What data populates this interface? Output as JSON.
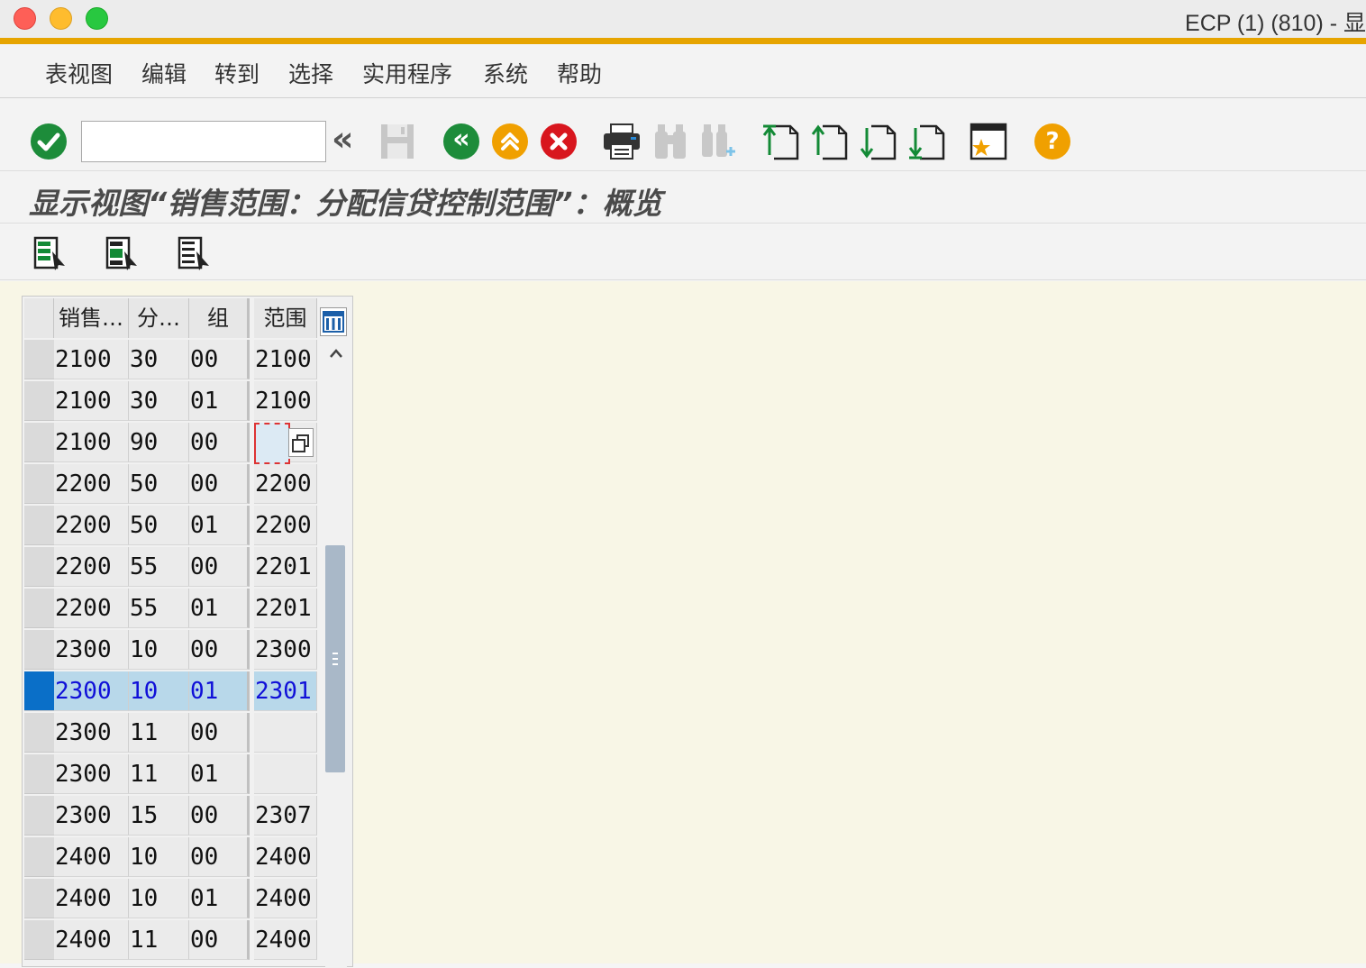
{
  "window": {
    "title": "ECP (1) (810) - 显"
  },
  "menu": [
    "表视图",
    "编辑",
    "转到",
    "选择",
    "实用程序",
    "系统",
    "帮助"
  ],
  "toolbar": {
    "command_value": "",
    "collapse_label": "«",
    "help_label": "?"
  },
  "screen_title": "显示视图“销售范围：分配信贷控制范围”：概览",
  "table": {
    "headers": [
      "销售…",
      "分…",
      "组",
      "范围"
    ],
    "selected_row_index": 8,
    "rows": [
      [
        "2100",
        "30",
        "00",
        "2100"
      ],
      [
        "2100",
        "30",
        "01",
        "2100"
      ],
      [
        "2100",
        "90",
        "00",
        ""
      ],
      [
        "2200",
        "50",
        "00",
        "2200"
      ],
      [
        "2200",
        "50",
        "01",
        "2200"
      ],
      [
        "2200",
        "55",
        "00",
        "2201"
      ],
      [
        "2200",
        "55",
        "01",
        "2201"
      ],
      [
        "2300",
        "10",
        "00",
        "2300"
      ],
      [
        "2300",
        "10",
        "01",
        "2301"
      ],
      [
        "2300",
        "11",
        "00",
        ""
      ],
      [
        "2300",
        "11",
        "01",
        ""
      ],
      [
        "2300",
        "15",
        "00",
        "2307"
      ],
      [
        "2400",
        "10",
        "00",
        "2400"
      ],
      [
        "2400",
        "10",
        "01",
        "2400"
      ],
      [
        "2400",
        "11",
        "00",
        "2400"
      ]
    ]
  },
  "colors": {
    "accent_bar": "#e6a400",
    "selection": "#b8d8ea",
    "selected_text": "#1010d8",
    "content_bg": "#f8f6e6"
  }
}
